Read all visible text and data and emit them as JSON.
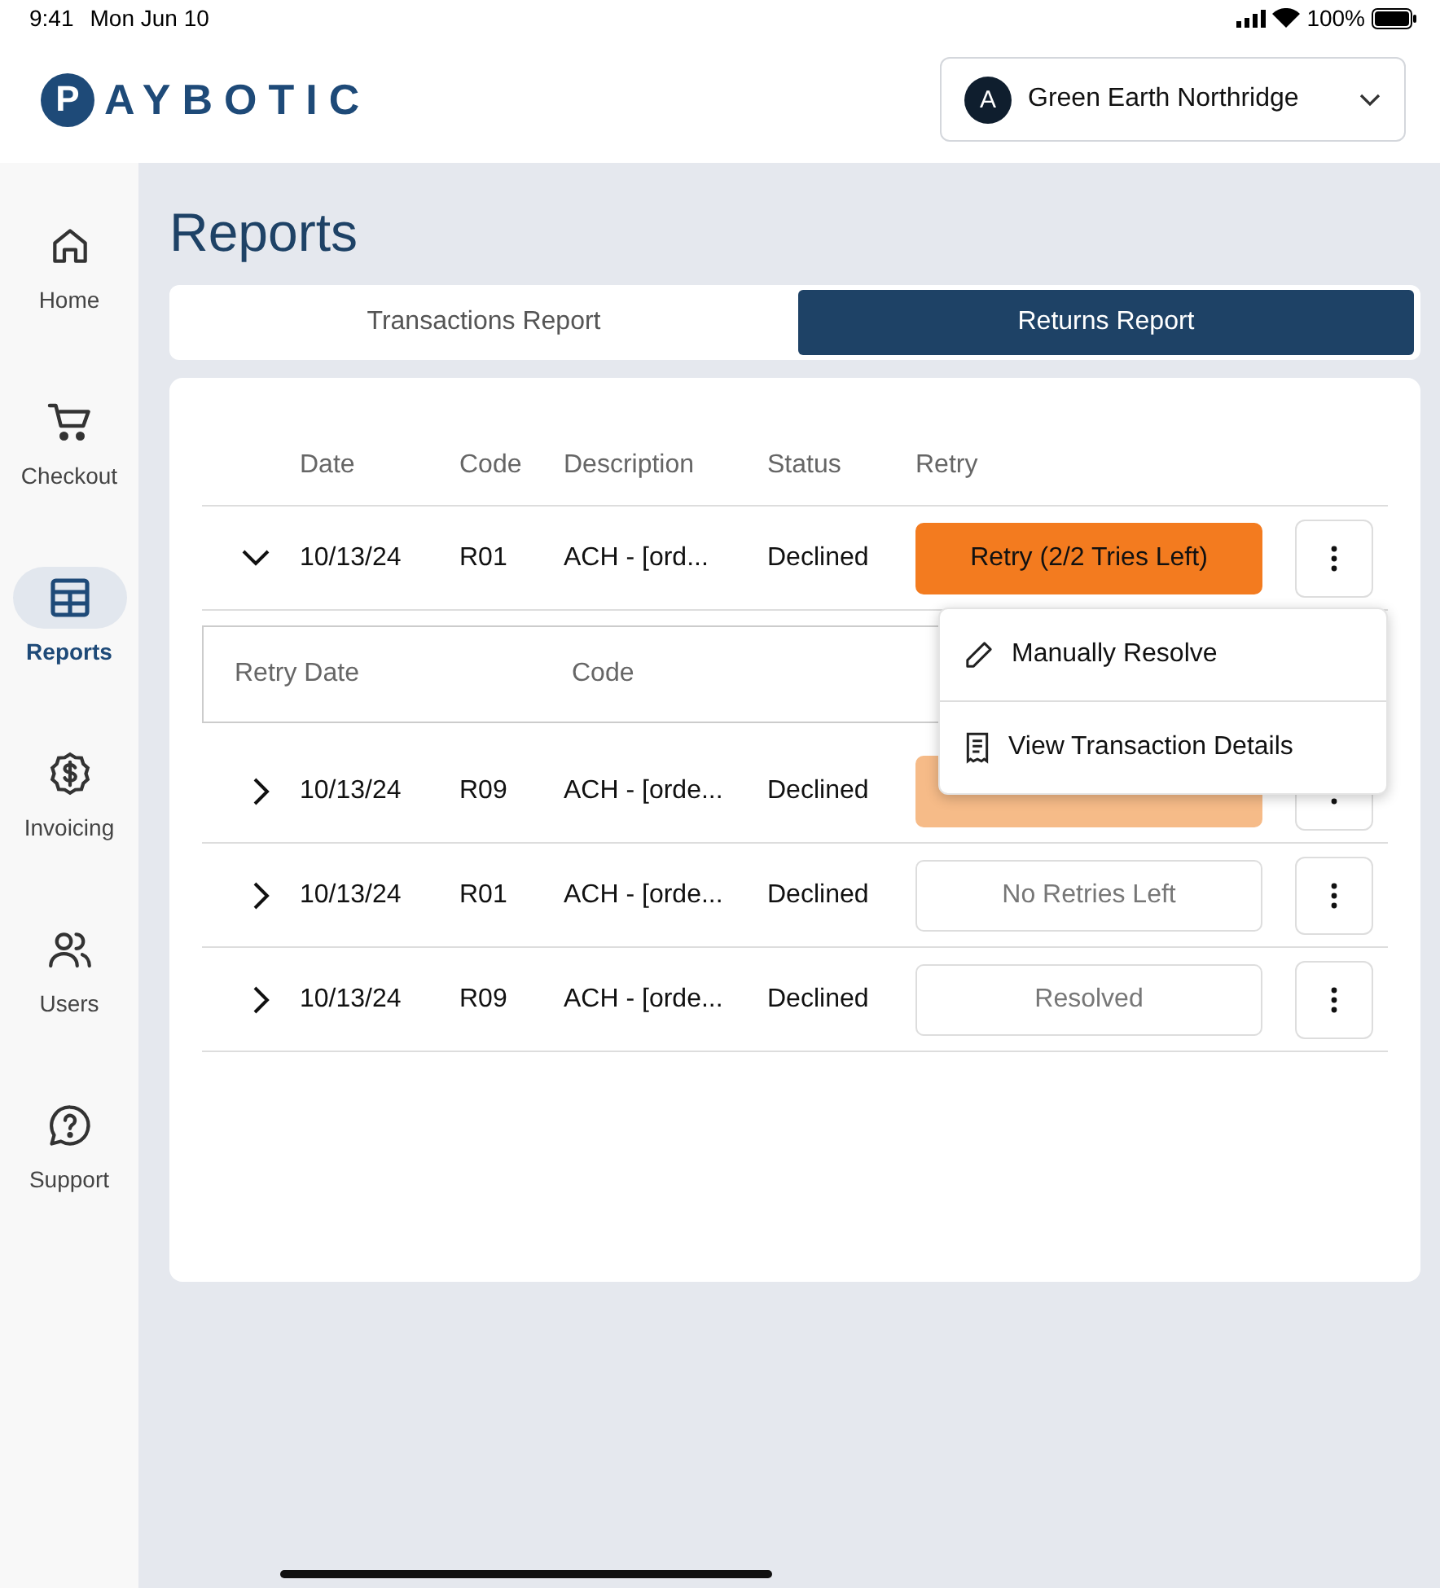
{
  "status_bar": {
    "time": "9:41",
    "date": "Mon Jun 10",
    "battery": "100%"
  },
  "logo": {
    "mark": "P",
    "text": "AYBOTIC"
  },
  "account": {
    "avatar": "A",
    "name": "Green Earth Northridge"
  },
  "sidebar": {
    "items": [
      {
        "label": "Home",
        "kind": "home",
        "selected": false
      },
      {
        "label": "Checkout",
        "kind": "cart",
        "selected": false
      },
      {
        "label": "Reports",
        "kind": "table",
        "selected": true
      },
      {
        "label": "Invoicing",
        "kind": "dollar",
        "selected": false
      },
      {
        "label": "Users",
        "kind": "users",
        "selected": false
      },
      {
        "label": "Support",
        "kind": "help",
        "selected": false
      }
    ]
  },
  "page_title": "Reports",
  "tabs": [
    {
      "label": "Transactions Report",
      "selected": false
    },
    {
      "label": "Returns Report",
      "selected": true
    }
  ],
  "table": {
    "columns": [
      "Date",
      "Code",
      "Description",
      "Status",
      "Retry"
    ],
    "rows": [
      {
        "expanded": true,
        "date": "10/13/24",
        "code": "R01",
        "description": "ACH - [ord...",
        "status": "Declined",
        "retry": {
          "kind": "active",
          "label": "Retry (2/2 Tries Left)"
        },
        "detail_columns": [
          "Retry Date",
          "Code"
        ]
      },
      {
        "expanded": false,
        "date": "10/13/24",
        "code": "R09",
        "description": "ACH - [orde...",
        "status": "Declined",
        "retry": {
          "kind": "faded"
        }
      },
      {
        "expanded": false,
        "date": "10/13/24",
        "code": "R01",
        "description": "ACH - [orde...",
        "status": "Declined",
        "retry": {
          "kind": "plain",
          "label": "No Retries Left"
        }
      },
      {
        "expanded": false,
        "date": "10/13/24",
        "code": "R09",
        "description": "ACH - [orde...",
        "status": "Declined",
        "retry": {
          "kind": "plain",
          "label": "Resolved"
        }
      }
    ]
  },
  "menu": {
    "items": [
      {
        "kind": "pencil",
        "label": "Manually Resolve"
      },
      {
        "kind": "document",
        "label": "View Transaction Details"
      }
    ]
  }
}
